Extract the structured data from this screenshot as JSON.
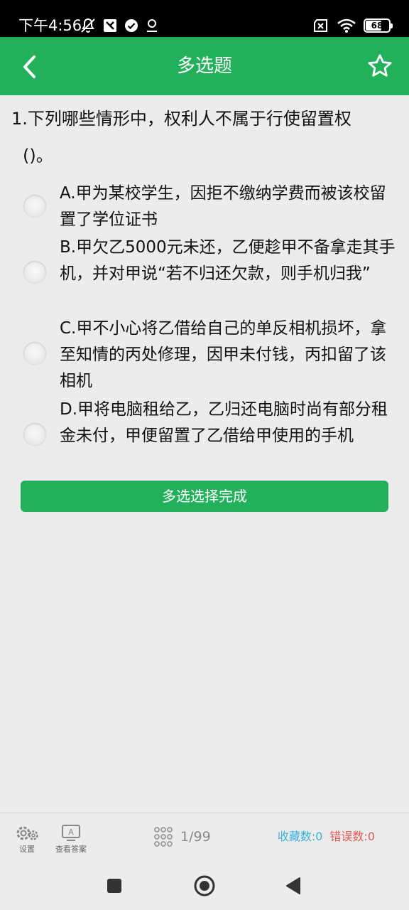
{
  "status_bar": {
    "time": "下午4:56",
    "battery": "68",
    "battery_level": 0.68,
    "icons_left": [
      "mute-icon",
      "app-icon",
      "check-circle-icon",
      "location-icon"
    ],
    "icons_right": [
      "sim-off-icon",
      "wifi-icon",
      "battery-icon"
    ]
  },
  "header": {
    "title": "多选题",
    "back_icon": "chevron-left-icon",
    "favorite_icon": "star-outline-icon"
  },
  "question": {
    "text": "1.下列哪些情形中，权利人不属于行使留置权",
    "blank": "()。",
    "options": [
      {
        "text": "A.甲为某校学生，因拒不缴纳学费而被该校留置了学位证书"
      },
      {
        "text": "B.甲欠乙5000元未还，乙便趁甲不备拿走其手机，并对甲说“若不归还欠款，则手机归我”"
      },
      {
        "text": "C.甲不小心将乙借给自己的单反相机损坏，拿至知情的丙处修理，因甲未付钱，丙扣留了该相机"
      },
      {
        "text": "D.甲将电脑租给乙，乙归还电脑时尚有部分租金未付，甲便留置了乙借给甲使用的手机"
      }
    ],
    "submit_label": "多选选择完成"
  },
  "bottom_bar": {
    "settings_label": "设置",
    "answer_label": "查看答案",
    "answer_icon_letter": "A",
    "progress": "1/99",
    "favorites": "收藏数:0",
    "errors": "错误数:0",
    "colors": {
      "accent": "#22b05b",
      "favorites": "#3ab0d9",
      "errors": "#e05a52"
    }
  }
}
